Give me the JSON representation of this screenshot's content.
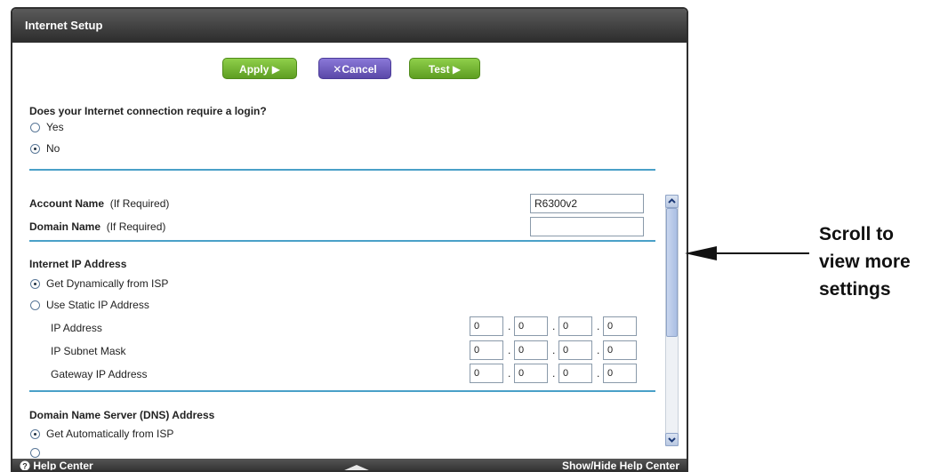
{
  "window": {
    "title": "Internet Setup"
  },
  "toolbar": {
    "apply_label": "Apply ▶",
    "cancel_label": "Cancel",
    "cancel_icon": "✕",
    "test_label": "Test ▶"
  },
  "login_question": {
    "label": "Does your Internet connection require a login?",
    "options": [
      {
        "label": "Yes",
        "selected": false
      },
      {
        "label": "No",
        "selected": true
      }
    ]
  },
  "account": {
    "label": "Account Name",
    "hint": "(If Required)",
    "value": "R6300v2"
  },
  "domain": {
    "label": "Domain Name",
    "hint": "(If Required)",
    "value": ""
  },
  "internet_ip": {
    "heading": "Internet IP Address",
    "options": [
      {
        "label": "Get Dynamically from ISP",
        "selected": true
      },
      {
        "label": "Use Static IP Address",
        "selected": false
      }
    ],
    "fields": [
      {
        "label": "IP Address",
        "octets": [
          "0",
          "0",
          "0",
          "0"
        ]
      },
      {
        "label": "IP Subnet Mask",
        "octets": [
          "0",
          "0",
          "0",
          "0"
        ]
      },
      {
        "label": "Gateway IP Address",
        "octets": [
          "0",
          "0",
          "0",
          "0"
        ]
      }
    ]
  },
  "dns": {
    "heading": "Domain Name Server (DNS) Address",
    "options": [
      {
        "label": "Get Automatically from ISP",
        "selected": true
      }
    ]
  },
  "footer": {
    "help_label": "Help Center",
    "toggle_label": "Show/Hide Help Center"
  },
  "annotation": {
    "lines": [
      "Scroll to",
      "view more",
      "settings"
    ]
  },
  "colors": {
    "accent_rule": "#4aa0c8",
    "apply_green": "#6fb02e",
    "cancel_purple": "#6a58b8"
  }
}
